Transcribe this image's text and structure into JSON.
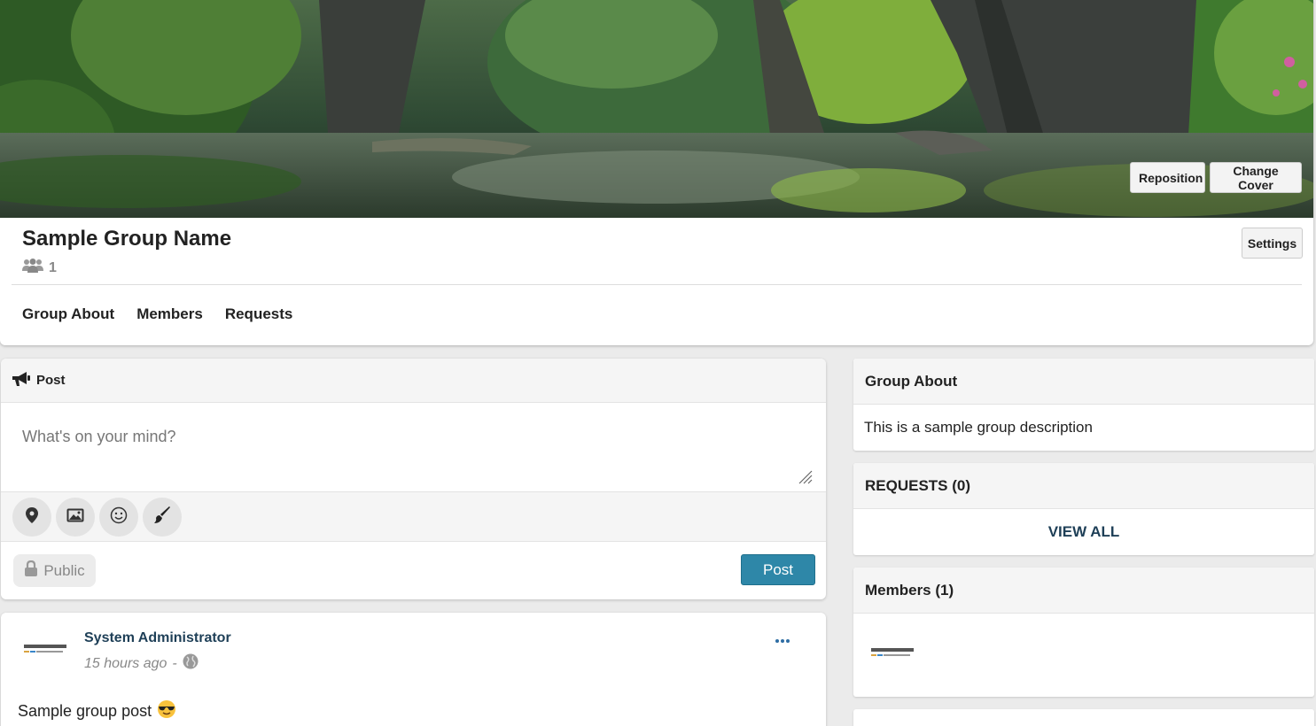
{
  "cover": {
    "reposition_label": "Reposition",
    "change_cover_label": "Change Cover"
  },
  "group": {
    "name": "Sample Group Name",
    "member_count": "1",
    "settings_label": "Settings",
    "nav": {
      "about": "Group About",
      "members": "Members",
      "requests": "Requests"
    }
  },
  "composer": {
    "title": "Post",
    "placeholder": "What's on your mind?",
    "tools": [
      "location-icon",
      "photo-icon",
      "emoji-icon",
      "brush-icon"
    ],
    "privacy_label": "Public",
    "submit_label": "Post"
  },
  "feed": {
    "post": {
      "author": "System Administrator",
      "time": "15 hours ago",
      "separator": "-",
      "text": "Sample group post",
      "emoji": "😎"
    }
  },
  "sidebar": {
    "about": {
      "title": "Group About",
      "description": "This is a sample group description"
    },
    "requests": {
      "title": "REQUESTS (0)",
      "view_all": "VIEW ALL"
    },
    "members": {
      "title": "Members (1)"
    }
  },
  "colors": {
    "accent": "#2e87a8",
    "link": "#1e3f57",
    "page_bg": "#ebebeb"
  }
}
